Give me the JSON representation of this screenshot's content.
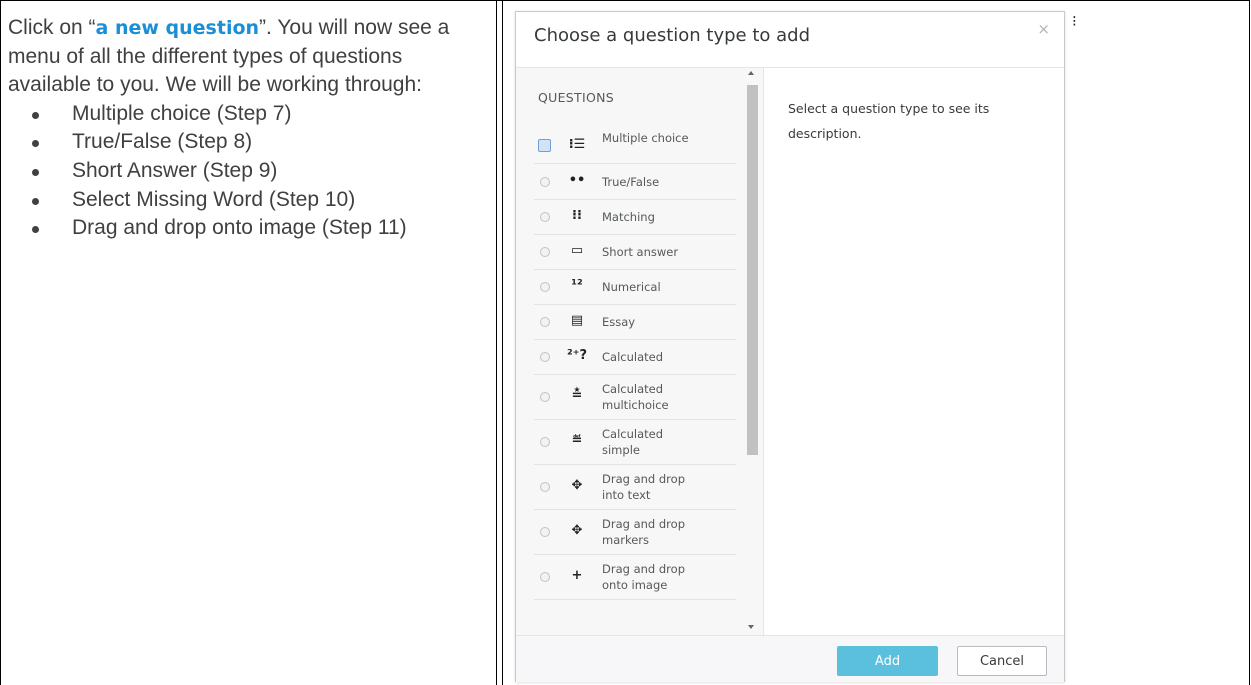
{
  "instructions": {
    "intro_before": "Click on “",
    "intro_link": "a new question",
    "intro_after": "”. You will now see a menu of all the different types of questions available to you. We will be working through:",
    "steps": [
      "Multiple choice (Step 7)",
      "True/False (Step 8)",
      "Short Answer (Step 9)",
      "Select Missing Word (Step 10)",
      "Drag and drop onto image (Step 11)"
    ]
  },
  "dialog": {
    "title": "Choose a question type to add",
    "close_glyph": "×",
    "section_label": "QUESTIONS",
    "description": "Select a question type to see its description.",
    "question_types": [
      {
        "label": "Multiple choice",
        "icon": "list-icon",
        "glyph": "⁝☰",
        "selected": true
      },
      {
        "label": "True/False",
        "icon": "two-dots-icon",
        "glyph": "••",
        "selected": false
      },
      {
        "label": "Matching",
        "icon": "matching-icon",
        "glyph": "⁝⁝",
        "selected": false
      },
      {
        "label": "Short answer",
        "icon": "short-answer-icon",
        "glyph": "▭",
        "selected": false
      },
      {
        "label": "Numerical",
        "icon": "numerical-icon",
        "glyph": "¹²",
        "selected": false
      },
      {
        "label": "Essay",
        "icon": "essay-icon",
        "glyph": "▤",
        "selected": false
      },
      {
        "label": "Calculated",
        "icon": "calculated-icon",
        "glyph": "²⁺?",
        "selected": false
      },
      {
        "label": "Calculated multichoice",
        "icon": "calculated-multichoice-icon",
        "glyph": "≛",
        "selected": false
      },
      {
        "label": "Calculated simple",
        "icon": "calculated-simple-icon",
        "glyph": "≝",
        "selected": false
      },
      {
        "label": "Drag and drop into text",
        "icon": "drag-drop-text-icon",
        "glyph": "✥",
        "selected": false
      },
      {
        "label": "Drag and drop markers",
        "icon": "drag-drop-markers-icon",
        "glyph": "✥",
        "selected": false
      },
      {
        "label": "Drag and drop onto image",
        "icon": "drag-drop-image-icon",
        "glyph": "+",
        "selected": false
      }
    ],
    "add_label": "Add",
    "cancel_label": "Cancel"
  },
  "edge_glyph": "⁝",
  "colors": {
    "link": "#1a8fd6",
    "add_button": "#5bc0de",
    "text": "#404040"
  }
}
